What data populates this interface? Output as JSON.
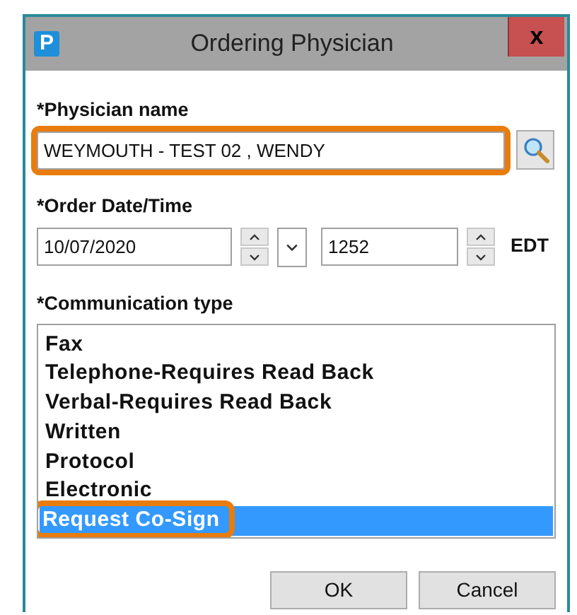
{
  "window": {
    "title": "Ordering Physician",
    "icon_letter": "P",
    "close": "x"
  },
  "physician": {
    "label": "*Physician name",
    "value": "WEYMOUTH - TEST 02 , WENDY",
    "highlighted": true
  },
  "order": {
    "label": "*Order Date/Time",
    "date": "10/07/2020",
    "time": "1252",
    "zone": "EDT"
  },
  "communication": {
    "label": "*Communication type",
    "items": [
      {
        "text": "Fax",
        "selected": false,
        "highlighted": false
      },
      {
        "text": "Telephone-Requires Read Back",
        "selected": false,
        "highlighted": false
      },
      {
        "text": "Verbal-Requires Read Back",
        "selected": false,
        "highlighted": false
      },
      {
        "text": "Written",
        "selected": false,
        "highlighted": false
      },
      {
        "text": "Protocol",
        "selected": false,
        "highlighted": false
      },
      {
        "text": "Electronic",
        "selected": false,
        "highlighted": false
      },
      {
        "text": "Request Co-Sign",
        "selected": true,
        "highlighted": true
      }
    ]
  },
  "buttons": [
    "OK",
    "Cancel"
  ]
}
